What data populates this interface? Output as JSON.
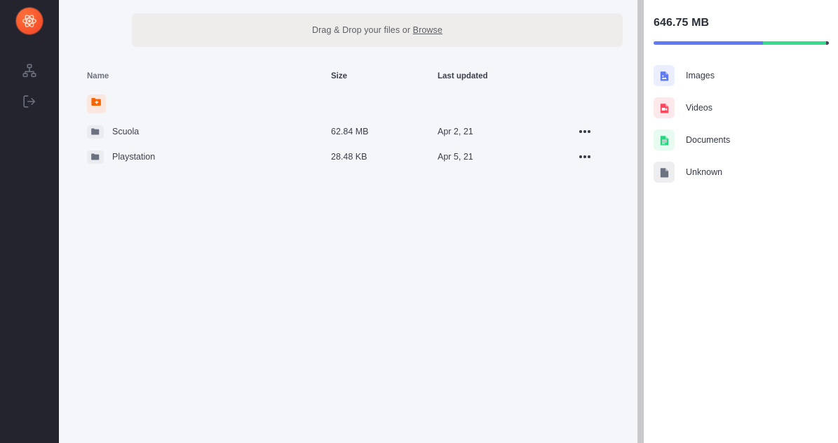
{
  "sidebar": {
    "logo": {
      "name": "atom-logo",
      "color": "#fa5c2e"
    },
    "items": [
      {
        "icon": "sitemap-icon",
        "label": "Sitemap"
      },
      {
        "icon": "logout-icon",
        "label": "Logout"
      }
    ]
  },
  "main": {
    "dropzone": {
      "text_prefix": "Drag & Drop your files or ",
      "browse_label": "Browse"
    },
    "new_folder_button": {
      "icon": "add-folder-icon",
      "label": "New folder"
    },
    "table": {
      "columns": [
        "Name",
        "Size",
        "Last updated"
      ],
      "rows": [
        {
          "icon": "folder-icon",
          "name": "Scuola",
          "size": "62.84 MB",
          "updated": "Apr 2, 21",
          "menu": "•••"
        },
        {
          "icon": "folder-icon",
          "name": "Playstation",
          "size": "28.48 KB",
          "updated": "Apr 5, 21",
          "menu": "•••"
        }
      ]
    }
  },
  "right_panel": {
    "storage_total": "646.75 MB",
    "storage_bar": {
      "segments": [
        {
          "name": "images",
          "color": "#6079f5",
          "percent": 62.5
        },
        {
          "name": "videos-documents",
          "color": "#37dd8f",
          "percent": 36
        },
        {
          "name": "unknown",
          "color": "#4a4258",
          "percent": 1.5
        }
      ]
    },
    "categories": [
      {
        "label": "Images",
        "icon": "file-image-icon",
        "icon_color": "#6079f5",
        "bg_color": "#ebeefe"
      },
      {
        "label": "Videos",
        "icon": "file-video-icon",
        "icon_color": "#f9475c",
        "bg_color": "#fde9ec"
      },
      {
        "label": "Documents",
        "icon": "file-lines-icon",
        "icon_color": "#2ad37f",
        "bg_color": "#e8fbf1"
      },
      {
        "label": "Unknown",
        "icon": "file-blank-icon",
        "icon_color": "#6b7280",
        "bg_color": "#eeeef0"
      }
    ]
  }
}
